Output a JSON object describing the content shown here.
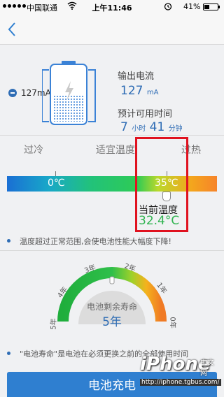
{
  "status_bar": {
    "carrier": "中国联通",
    "time": "上午11:46",
    "battery_percent": "41%",
    "battery_level": 0.41
  },
  "battery": {
    "current_left": "127mA",
    "output_current_label": "输出电流",
    "output_current_value": "127",
    "output_current_unit": "mA",
    "remaining_time_label": "预计可用时间",
    "hours_value": "7",
    "hours_unit": "小时",
    "minutes_value": "41",
    "minutes_unit": "分钟"
  },
  "temperature": {
    "label_cold": "过冷",
    "label_normal": "适宜温度",
    "label_hot": "过热",
    "bar_low": "0℃",
    "bar_high": "35℃",
    "current_label": "当前温度",
    "current_value": "32.4°C",
    "note": "温度超过正常范围,会使电池性能大幅度下降!"
  },
  "lifespan": {
    "years": [
      "5年",
      "4年",
      "3年",
      "2年",
      "1年",
      "0年"
    ],
    "remaining_label": "电池剩余寿命",
    "remaining_value": "5年",
    "note": "\"电池寿命\"是电池在必须更换之前的全部使用时间"
  },
  "charge_button": {
    "label": "电池充电"
  },
  "watermark": {
    "brand": "iPhone",
    "cn": "中文网",
    "url": "http://iphone.tgbus.com/"
  },
  "colors": {
    "accent": "#2f6db5",
    "green": "#2fb34f",
    "highlight": "#e0121f",
    "button": "#2f7fd0"
  }
}
